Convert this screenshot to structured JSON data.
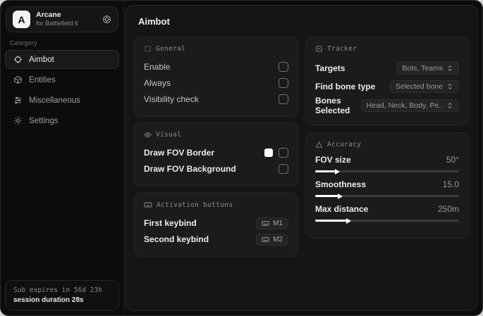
{
  "colors": {
    "accent_swatch": "#ffffff",
    "window_bg": "#0c0c0c",
    "panel_bg": "#151515",
    "card_bg": "#1b1b1b"
  },
  "sidebar": {
    "brand": {
      "initial": "A",
      "name": "Arcane",
      "subtitle": "for Battlefield 6"
    },
    "category_label": "Category",
    "items": [
      {
        "label": "Aimbot",
        "icon": "crosshair-icon",
        "active": true
      },
      {
        "label": "Entities",
        "icon": "cube-icon",
        "active": false
      },
      {
        "label": "Miscellaneous",
        "icon": "sliders-icon",
        "active": false
      },
      {
        "label": "Settings",
        "icon": "gear-icon",
        "active": false
      }
    ],
    "status": {
      "line1": "Sub expires in 56d 23h",
      "line2": "session duration 28s"
    }
  },
  "main": {
    "title": "Aimbot",
    "cards": {
      "general": {
        "title": "General",
        "rows": [
          {
            "label": "Enable",
            "checked": false
          },
          {
            "label": "Always",
            "checked": false
          },
          {
            "label": "Visibility check",
            "checked": false
          }
        ]
      },
      "visual": {
        "title": "Visual",
        "rows": [
          {
            "label": "Draw FOV Border",
            "swatch": "#ffffff",
            "checked": false
          },
          {
            "label": "Draw FOV Background",
            "checked": false
          }
        ]
      },
      "activation": {
        "title": "Activation buttons",
        "rows": [
          {
            "label": "First keybind",
            "key": "M1"
          },
          {
            "label": "Second keybind",
            "key": "M2"
          }
        ]
      },
      "tracker": {
        "title": "Tracker",
        "rows": [
          {
            "label": "Targets",
            "value": "Bots, Teams"
          },
          {
            "label": "Find bone type",
            "value": "Selected bone"
          },
          {
            "label": "Bones Selected",
            "value": "Head, Neck, Body, Pe.."
          }
        ]
      },
      "accuracy": {
        "title": "Accuracy",
        "sliders": [
          {
            "label": "FOV size",
            "value": "50°",
            "percent": 14
          },
          {
            "label": "Smoothness",
            "value": "15.0",
            "percent": 16
          },
          {
            "label": "Max distance",
            "value": "250m",
            "percent": 22
          }
        ]
      }
    }
  }
}
